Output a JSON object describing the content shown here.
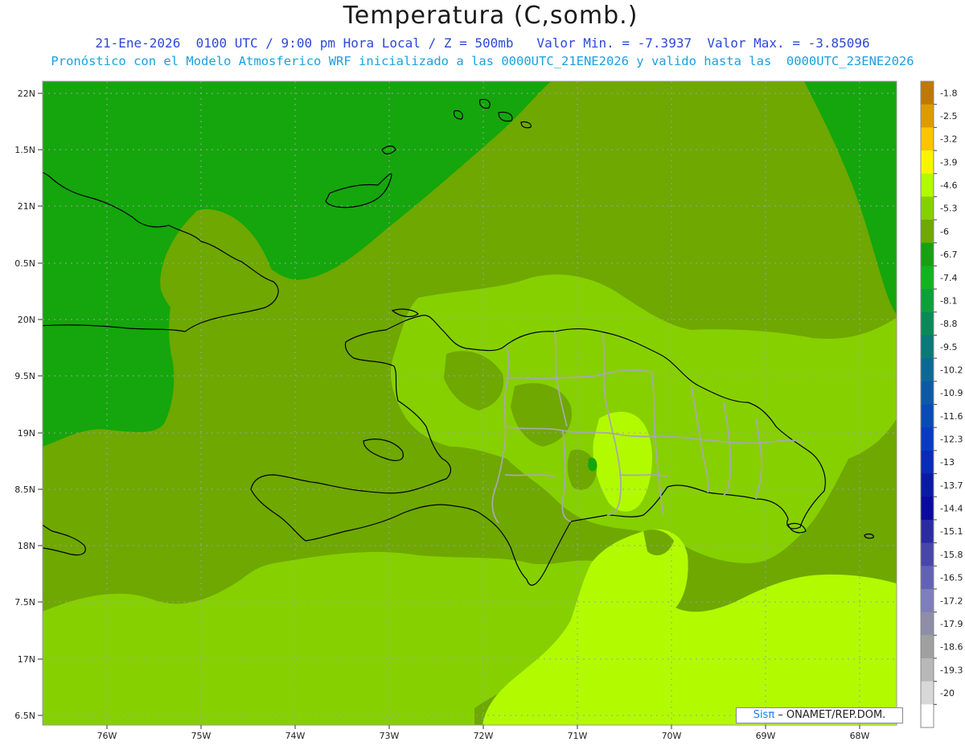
{
  "title": "Temperatura (C,somb.)",
  "subtitle_line1": "21-Ene-2026  0100 UTC / 9:00 pm Hora Local / Z = 500mb   Valor Min. = -7.3937  Valor Max. = -3.85096",
  "subtitle_line2": "Pronóstico con el Modelo Atmosferico WRF inicializado a las 0000UTC_21ENE2026 y valido hasta las  0000UTC_23ENE2026",
  "credit": {
    "brand": "Sisπ",
    "text": " – ONAMET/REP.DOM."
  },
  "map": {
    "lat_labels": [
      "22N",
      "1.5N",
      "21N",
      "0.5N",
      "20N",
      "9.5N",
      "19N",
      "8.5N",
      "18N",
      "7.5N",
      "17N",
      "6.5N"
    ],
    "lon_labels": [
      "76W",
      "75W",
      "74W",
      "73W",
      "72W",
      "71W",
      "70W",
      "69W",
      "68W"
    ],
    "grid": "dotted",
    "valor_min": -7.3937,
    "valor_max": -3.85096
  },
  "colorbar": {
    "labels": [
      "-1.8",
      "-2.5",
      "-3.2",
      "-3.9",
      "-4.6",
      "-5.3",
      "-6",
      "-6.7",
      "-7.4",
      "-8.1",
      "-8.8",
      "-9.5",
      "-10.2",
      "-10.9",
      "-11.6",
      "-12.3",
      "-13",
      "-13.7",
      "-14.4",
      "-15.1",
      "-15.8",
      "-16.5",
      "-17.2",
      "-17.9",
      "-18.6",
      "-19.3",
      "-20"
    ],
    "colors": [
      "#c07800",
      "#e09a00",
      "#ffc400",
      "#f8f400",
      "#b2fa00",
      "#86d000",
      "#6ea800",
      "#16a20e",
      "#10b41e",
      "#0aa03a",
      "#088a58",
      "#087a78",
      "#0a6a94",
      "#0a5aa8",
      "#0a4ab8",
      "#0a3ac4",
      "#0a2ab8",
      "#0a1aa8",
      "#0a0aa0",
      "#2a2aa4",
      "#4646ac",
      "#6262b4",
      "#7e7ebc",
      "#8e8ea8",
      "#a0a0a0",
      "#b8b8b8",
      "#d8d8d8",
      "#ffffff"
    ]
  },
  "field_colors": {
    "darker_green": "#14a60c",
    "mid_green": "#6ea800",
    "light_green": "#86d000",
    "yellow_green": "#b2fa00"
  }
}
